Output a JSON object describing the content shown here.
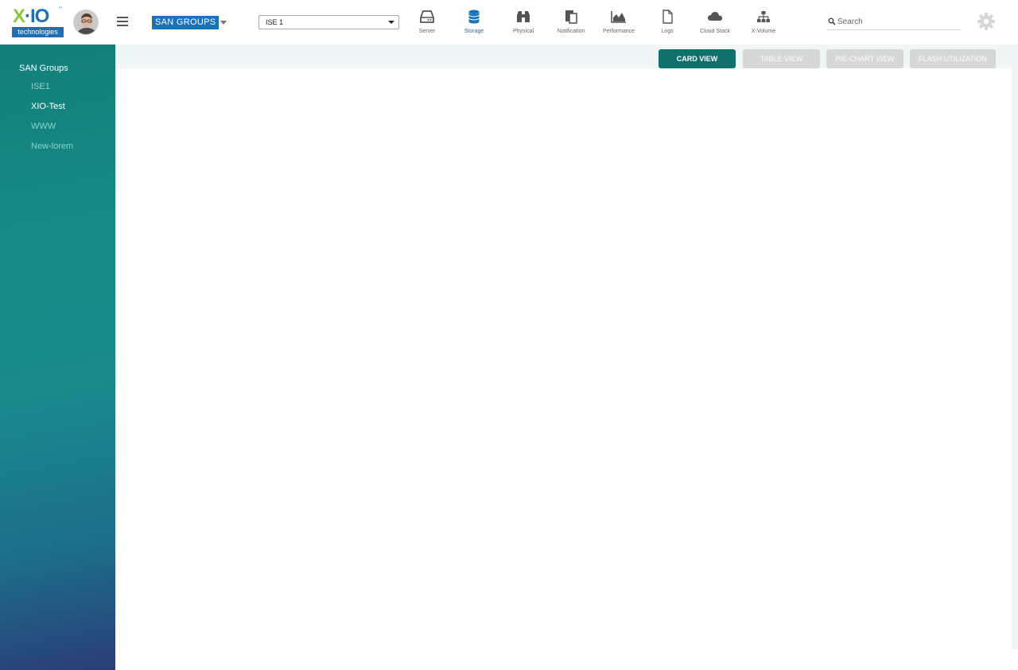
{
  "app": {
    "logo_main_a": "X",
    "logo_main_b": "·IO",
    "logo_tm": "™",
    "logo_sub": "technologies"
  },
  "header": {
    "group_selector_label": "SAN GROUPS",
    "system_select_value": "ISE 1",
    "search_placeholder": "Search",
    "nav": [
      {
        "label": "Server",
        "icon": "hard-drive-icon"
      },
      {
        "label": "Storage",
        "icon": "database-icon",
        "active": true
      },
      {
        "label": "Physical",
        "icon": "binoculars-icon"
      },
      {
        "label": "Notification",
        "icon": "clipboard-icon"
      },
      {
        "label": "Performance",
        "icon": "area-chart-icon"
      },
      {
        "label": "Logs",
        "icon": "file-icon"
      },
      {
        "label": "Cloud Stack",
        "icon": "cloud-icon"
      },
      {
        "label": "X-Volume",
        "icon": "sitemap-icon"
      }
    ]
  },
  "sidebar": {
    "title": "SAN Groups",
    "items": [
      {
        "label": "ISE1"
      },
      {
        "label": "XIO-Test",
        "active": true
      },
      {
        "label": "WWW"
      },
      {
        "label": "New-lorem"
      }
    ]
  },
  "views": {
    "card": "CARD VIEW",
    "table": "TABLE VIEW",
    "pie": "PIE-CHART VIEW",
    "flash": "FLASH UTILIZATION",
    "active": "card"
  },
  "colors": {
    "accent": "#1a73b8",
    "sidebar_teal": "#168a86",
    "active_button": "#10706b"
  }
}
